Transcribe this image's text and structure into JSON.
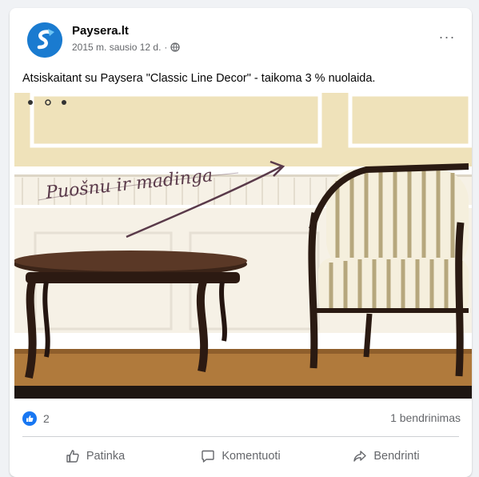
{
  "post": {
    "page_name": "Paysera.lt",
    "timestamp": "2015 m. sausio 12 d.",
    "separator": "·",
    "more_label": "···",
    "text": "Atsiskaitant su Paysera \"Classic Line Decor\" - taikoma 3 % nuolaida.",
    "image_caption": "Puošnu ir madinga",
    "icons": {
      "avatar": "paysera-logo-icon",
      "audience": "globe-icon",
      "more": "more-options-icon",
      "reaction": "like-reaction-icon",
      "like": "thumbs-up-icon",
      "comment": "comment-icon",
      "share": "share-icon"
    }
  },
  "stats": {
    "reactions_count": "2",
    "shares": "1 bendrinimas"
  },
  "actions": {
    "like": "Patinka",
    "comment": "Komentuoti",
    "share": "Bendrinti"
  },
  "colors": {
    "brand": "#1a7bd0",
    "like_blue": "#1877f2",
    "secondary_text": "#65676b",
    "background": "#f0f2f5"
  }
}
